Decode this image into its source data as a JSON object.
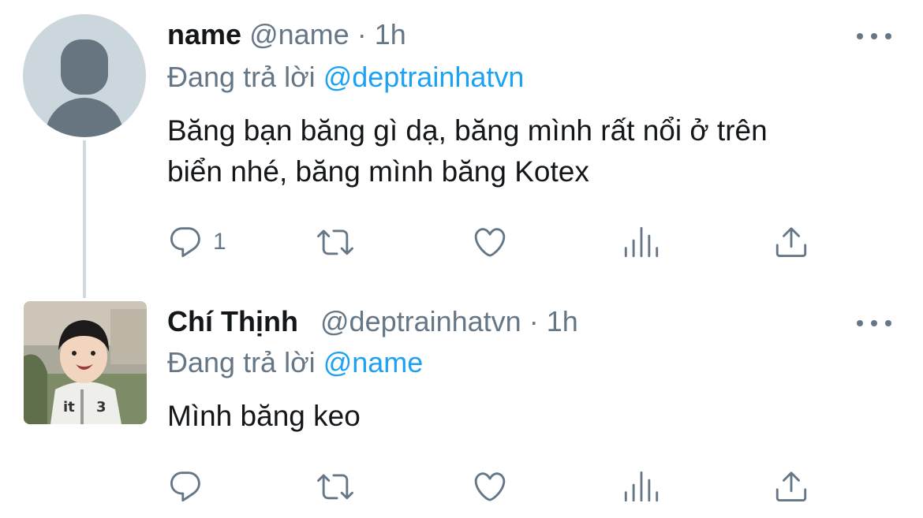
{
  "colors": {
    "text": "#14171a",
    "secondary": "#657786",
    "link": "#1da1f2",
    "thread_line": "#cfd9de"
  },
  "tweets": [
    {
      "display_name": "name",
      "handle": "@name",
      "separator": "·",
      "time": "1h",
      "reply_prefix": "Đang trả lời",
      "reply_to": "@deptrainhatvn",
      "text_lines": [
        "Băng bạn băng gì dạ, băng mình rất nổi ở trên",
        "biển nhé, băng mình băng Kotex"
      ],
      "reply_count": "1",
      "avatar": "default-avatar-icon"
    },
    {
      "display_name": "Chí Thịnh",
      "handle": "@deptrainhatvn",
      "separator": "·",
      "time": "1h",
      "reply_prefix": "Đang trả lời",
      "reply_to": "@name",
      "text_lines": [
        "Mình băng keo"
      ],
      "avatar": "profile-photo"
    }
  ],
  "icons": [
    "reply-icon",
    "retweet-icon",
    "like-icon",
    "analytics-icon",
    "share-icon",
    "more-icon"
  ]
}
